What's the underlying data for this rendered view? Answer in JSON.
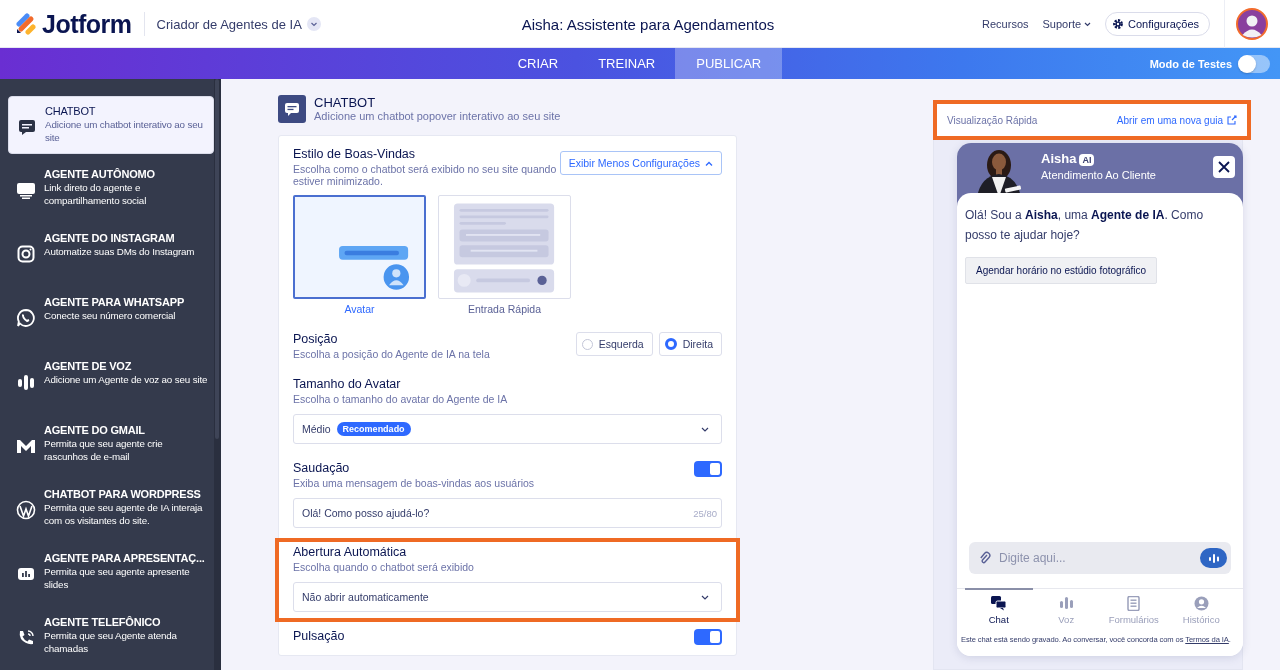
{
  "header": {
    "logo": "Jotform",
    "product": "Criador de Agentes de IA",
    "title": "Aisha: Assistente para Agendamentos",
    "links": [
      {
        "label": "Recursos",
        "kind": "link"
      },
      {
        "label": "Suporte",
        "kind": "menu"
      }
    ],
    "settings_button": "Configurações"
  },
  "nav": {
    "tabs": [
      {
        "label": "CRIAR",
        "selected": false
      },
      {
        "label": "TREINAR",
        "selected": false
      },
      {
        "label": "PUBLICAR",
        "selected": true
      }
    ],
    "test_mode": {
      "label": "Modo de Testes",
      "on": false
    }
  },
  "sidebar": {
    "items": [
      {
        "title": "CHATBOT",
        "description": "Adicione um chatbot interativo ao seu site",
        "selected": true
      },
      {
        "title": "AGENTE AUTÔNOMO",
        "description": "Link direto do agente e compartilhamento social",
        "selected": false
      },
      {
        "title": "AGENTE DO INSTAGRAM",
        "description": "Automatize suas DMs do Instagram",
        "selected": false
      },
      {
        "title": "AGENTE PARA WHATSAPP",
        "description": "Conecte seu número comercial",
        "selected": false
      },
      {
        "title": "AGENTE DE VOZ",
        "description": "Adicione um Agente de voz ao seu site",
        "selected": false
      },
      {
        "title": "AGENTE DO GMAIL",
        "description": "Permita que seu agente crie rascunhos de e-mail",
        "selected": false
      },
      {
        "title": "CHATBOT PARA WORDPRESS",
        "description": "Permita que seu agente de IA interaja com os visitantes do site.",
        "selected": false
      },
      {
        "title": "AGENTE PARA APRESENTAÇ...",
        "description": "Permita que seu agente apresente slides",
        "selected": false
      },
      {
        "title": "AGENTE TELEFÔNICO",
        "description": "Permita que seu Agente atenda chamadas",
        "selected": false
      }
    ]
  },
  "settings": {
    "title": "CHATBOT",
    "description": "Adicione um chatbot popover interativo ao seu site",
    "sections": [
      {
        "kind": "styles",
        "title": "Estilo de Boas-Vindas",
        "description": "Escolha como o chatbot será exibido no seu site quando estiver minimizado.",
        "button": "Exibir Menos Configurações",
        "expanded": true,
        "highlighted": false,
        "options": [
          {
            "label": "Avatar",
            "selected": true
          },
          {
            "label": "Entrada Rápida",
            "selected": false
          }
        ]
      },
      {
        "kind": "radio",
        "title": "Posição",
        "description": "Escolha a posição do Agente de IA na tela",
        "highlighted": false,
        "options": [
          {
            "label": "Esquerda",
            "selected": false
          },
          {
            "label": "Direita",
            "selected": true
          }
        ]
      },
      {
        "kind": "select",
        "title": "Tamanho do Avatar",
        "description": "Escolha o tamanho do avatar do Agente de IA",
        "value": "Médio",
        "badge": "Recomendado",
        "highlighted": false
      },
      {
        "kind": "toggle_input",
        "title": "Saudação",
        "description": "Exiba uma mensagem de boas-vindas aos usuários",
        "on": true,
        "value": "Olá! Como posso ajudá-lo?",
        "counter": "25/80",
        "highlighted": false
      },
      {
        "kind": "select",
        "title": "Abertura Automática",
        "description": "Escolha quando o chatbot será exibido",
        "value": "Não abrir automaticamente",
        "highlighted": true
      },
      {
        "kind": "toggle",
        "title": "Pulsação",
        "on": true,
        "highlighted": false
      }
    ]
  },
  "preview": {
    "title": "Visualização Rápida",
    "open_link": "Abrir em uma nova guia",
    "highlighted": true,
    "chat": {
      "agent_name": "Aisha",
      "agent_badge": "AI",
      "agent_role": "Atendimento Ao Cliente",
      "message": "Olá! Sou a **Aisha**, uma **Agente de IA**. Como posso te ajudar hoje?",
      "suggestions": [
        "Agendar horário no estúdio fotográfico"
      ],
      "input_placeholder": "Digite aqui...",
      "tabs": [
        {
          "label": "Chat",
          "selected": true
        },
        {
          "label": "Voz",
          "selected": false
        },
        {
          "label": "Formulários",
          "selected": false
        },
        {
          "label": "Histórico",
          "selected": false
        }
      ],
      "footer": {
        "text": "Este chat está sendo gravado. Ao conversar, você concorda com os ",
        "link": "Termos da IA",
        "end": "."
      }
    }
  }
}
